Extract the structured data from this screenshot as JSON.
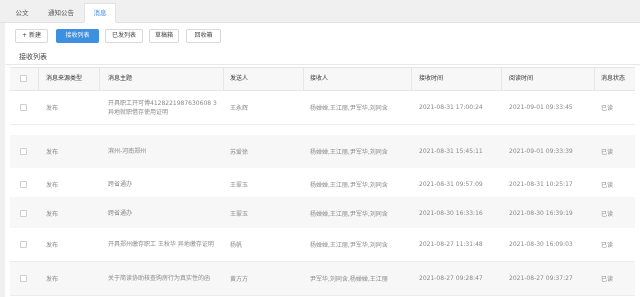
{
  "tabs": [
    {
      "label": "公文"
    },
    {
      "label": "通知公告"
    },
    {
      "label": "消息"
    }
  ],
  "toolbar": {
    "new_label": "+ 新建",
    "received_label": "接收列表",
    "sent_label": "已发列表",
    "draft_label": "草稿箱",
    "recycle_label": "回收箱"
  },
  "section_title": "接收列表",
  "table": {
    "columns": [
      "消息来源类型",
      "消息主题",
      "发送人",
      "接收人",
      "接收时间",
      "阅读时间",
      "消息状态"
    ],
    "rows": [
      {
        "type": "发布",
        "subject": "开具职工开可博4128221987630608 3异地就职借存使用证明",
        "sender": "王永辉",
        "receiver": "杨婵婵,王江丽,尹军华,刘同含",
        "recv_time": "2021-08-31 17:00:24",
        "read_time": "2021-09-01 09:33:45",
        "status": "已读"
      },
      {
        "type": "发布",
        "subject": "滨州-河南郑州",
        "sender": "苏爱徐",
        "receiver": "杨婵婵,王江丽,尹军华,刘同含",
        "recv_time": "2021-08-31 15:45:11",
        "read_time": "2021-09-01 09:33:39",
        "status": "已读"
      },
      {
        "type": "发布",
        "subject": "跨省通办",
        "sender": "王翠玉",
        "receiver": "杨婵婵,王江丽,尹军华,刘同含",
        "recv_time": "2021-08-31 09:57:09",
        "read_time": "2021-08-31 10:25:17",
        "status": "已读"
      },
      {
        "type": "发布",
        "subject": "跨省通办",
        "sender": "王翠玉",
        "receiver": "杨婵婵,王江丽,尹军华,刘同含",
        "recv_time": "2021-08-30 16:33:16",
        "read_time": "2021-08-30 16:39:19",
        "status": "已读"
      },
      {
        "type": "发布",
        "subject": "开具郑州缴存职工 王秋华 异地缴存证明",
        "sender": "杨帆",
        "receiver": "杨婵婵,王江丽,尹军华,刘同含",
        "recv_time": "2021-08-27 11:31:48",
        "read_time": "2021-08-30 16:09:03",
        "status": "已读"
      },
      {
        "type": "发布",
        "subject": "关于简读协助核查购房行为真实性的函",
        "sender": "黄方方",
        "receiver": "尹军华,刘同含,杨婵婵,王江丽",
        "recv_time": "2021-08-27 09:28:47",
        "read_time": "2021-08-27 09:37:27",
        "status": "已读"
      }
    ]
  }
}
